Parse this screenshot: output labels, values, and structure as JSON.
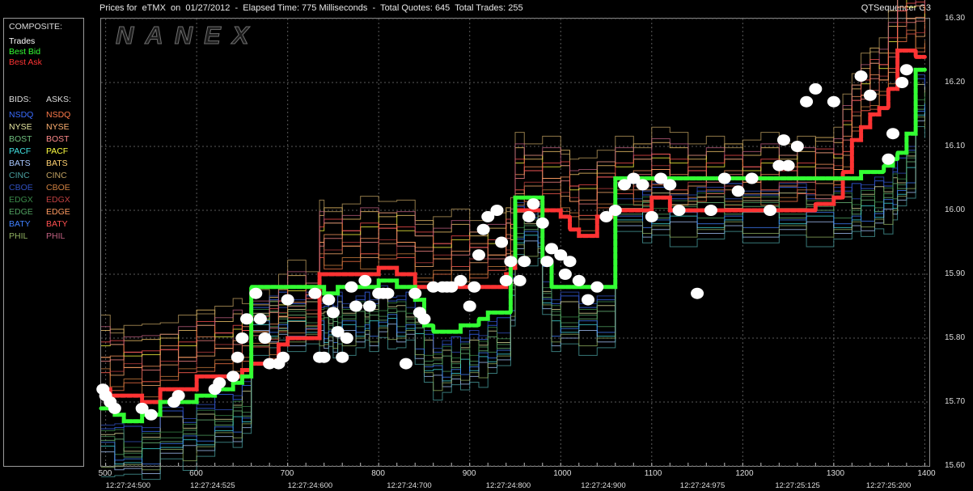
{
  "header": {
    "title": "Prices for  eTMX  on  01/27/2012  -  Elapsed Time: 775 Milliseconds  -  Total Quotes: 645  Total Trades: 255",
    "app": "QTSequencer G3"
  },
  "watermark": "NANEX",
  "legend": {
    "composite_title": "COMPOSITE:",
    "composite": [
      {
        "label": "Trades",
        "color": "#ffffff"
      },
      {
        "label": "Best Bid",
        "color": "#33ff33"
      },
      {
        "label": "Best Ask",
        "color": "#ff3333"
      }
    ],
    "bids_title": "BIDS:",
    "asks_title": "ASKS:",
    "exchanges": [
      {
        "bid": "NSDQ",
        "ask": "NSDQ",
        "bid_color": "#3a6cff",
        "ask_color": "#ff7a4a"
      },
      {
        "bid": "NYSE",
        "ask": "NYSE",
        "bid_color": "#e6e6a0",
        "ask_color": "#ffb070"
      },
      {
        "bid": "BOST",
        "ask": "BOST",
        "bid_color": "#6fc07f",
        "ask_color": "#ff8a8a"
      },
      {
        "bid": "PACF",
        "ask": "PACF",
        "bid_color": "#40e0e0",
        "ask_color": "#ffff40"
      },
      {
        "bid": "BATS",
        "ask": "BATS",
        "bid_color": "#a8c8ff",
        "ask_color": "#ffd070"
      },
      {
        "bid": "CINC",
        "ask": "CINC",
        "bid_color": "#4aa0a0",
        "ask_color": "#c0a060"
      },
      {
        "bid": "CBOE",
        "ask": "CBOE",
        "bid_color": "#3050c0",
        "ask_color": "#d08040"
      },
      {
        "bid": "EDGX",
        "ask": "EDGX",
        "bid_color": "#3a8a4a",
        "ask_color": "#c04040"
      },
      {
        "bid": "EDGE",
        "ask": "EDGE",
        "bid_color": "#50a060",
        "ask_color": "#ff9a60"
      },
      {
        "bid": "BATY",
        "ask": "BATY",
        "bid_color": "#4080ff",
        "ask_color": "#ff5050"
      },
      {
        "bid": "PHIL",
        "ask": "PHIL",
        "bid_color": "#90b060",
        "ask_color": "#c06080"
      }
    ]
  },
  "chart_data": {
    "type": "line",
    "title": "Prices for  eTMX  on  01/27/2012",
    "x_seq_ticks": [
      "500",
      "600",
      "700",
      "800",
      "900",
      "1000",
      "1100",
      "1200",
      "1300",
      "1400"
    ],
    "x_time_ticks": [
      "12:27:24:500",
      "12:27:24:525",
      "12:27:24:600",
      "12:27:24:700",
      "12:27:24:800",
      "12:27:24:900",
      "12:27:24:975",
      "12:27:25:125",
      "12:27:25:200"
    ],
    "y_ticks": [
      "16.30",
      "16.20",
      "16.10",
      "16.00",
      "15.90",
      "15.80",
      "15.70",
      "15.60"
    ],
    "xlim": [
      495,
      1405
    ],
    "ylim": [
      15.6,
      16.3
    ],
    "grid": true,
    "series": [
      {
        "name": "Best Bid",
        "color": "#33ff33",
        "x": [
          495,
          510,
          520,
          540,
          560,
          585,
          600,
          620,
          640,
          650,
          660,
          680,
          690,
          700,
          720,
          735,
          740,
          745,
          750,
          755,
          760,
          775,
          785,
          790,
          800,
          810,
          820,
          830,
          840,
          850,
          860,
          870,
          880,
          890,
          900,
          910,
          920,
          930,
          945,
          950,
          960,
          975,
          980,
          990,
          1000,
          1020,
          1040,
          1060,
          1090,
          1100,
          1120,
          1150,
          1180,
          1200,
          1240,
          1270,
          1300,
          1320,
          1330,
          1345,
          1355,
          1365,
          1370,
          1380,
          1390,
          1400
        ],
        "y": [
          15.69,
          15.68,
          15.67,
          15.68,
          15.7,
          15.7,
          15.71,
          15.72,
          15.73,
          15.74,
          15.88,
          15.88,
          15.88,
          15.88,
          15.88,
          15.88,
          15.87,
          15.87,
          15.87,
          15.88,
          15.88,
          15.88,
          15.88,
          15.88,
          15.89,
          15.89,
          15.88,
          15.88,
          15.86,
          15.82,
          15.81,
          15.81,
          15.81,
          15.82,
          15.82,
          15.83,
          15.84,
          15.84,
          15.92,
          16.02,
          16.02,
          16.02,
          15.92,
          15.88,
          15.88,
          15.88,
          15.88,
          16.05,
          16.05,
          16.05,
          16.05,
          16.05,
          16.05,
          16.05,
          16.05,
          16.05,
          16.05,
          16.05,
          16.06,
          16.06,
          16.07,
          16.08,
          16.09,
          16.12,
          16.22,
          16.22
        ]
      },
      {
        "name": "Best Ask",
        "color": "#ff3333",
        "x": [
          495,
          505,
          520,
          540,
          560,
          580,
          600,
          620,
          640,
          650,
          660,
          680,
          690,
          700,
          720,
          735,
          740,
          760,
          780,
          800,
          820,
          840,
          860,
          880,
          900,
          920,
          940,
          945,
          950,
          960,
          980,
          1000,
          1010,
          1020,
          1040,
          1060,
          1080,
          1100,
          1120,
          1140,
          1160,
          1180,
          1200,
          1220,
          1240,
          1260,
          1280,
          1300,
          1310,
          1320,
          1330,
          1340,
          1350,
          1360,
          1370,
          1380,
          1390,
          1400
        ],
        "y": [
          15.72,
          15.71,
          15.71,
          15.7,
          15.72,
          15.72,
          15.74,
          15.74,
          15.74,
          15.75,
          15.76,
          15.76,
          15.79,
          15.8,
          15.8,
          15.9,
          15.9,
          15.9,
          15.9,
          15.91,
          15.9,
          15.88,
          15.88,
          15.88,
          15.88,
          15.88,
          15.9,
          15.91,
          16.0,
          16.0,
          16.0,
          15.99,
          15.97,
          15.96,
          15.99,
          16.0,
          16.0,
          16.02,
          16.0,
          16.0,
          16.0,
          16.0,
          16.0,
          16.0,
          16.0,
          16.0,
          16.01,
          16.02,
          16.06,
          16.11,
          16.13,
          16.15,
          16.16,
          16.19,
          16.25,
          16.25,
          16.24,
          16.24
        ]
      },
      {
        "name": "Trades",
        "color": "#ffffff",
        "x": [
          497,
          500,
          505,
          510,
          540,
          550,
          575,
          580,
          620,
          625,
          640,
          645,
          650,
          655,
          665,
          670,
          675,
          680,
          690,
          695,
          700,
          730,
          735,
          740,
          745,
          750,
          755,
          760,
          765,
          770,
          775,
          785,
          790,
          800,
          805,
          810,
          830,
          840,
          845,
          850,
          860,
          870,
          875,
          880,
          890,
          900,
          905,
          910,
          915,
          920,
          930,
          935,
          940,
          945,
          955,
          960,
          965,
          970,
          980,
          985,
          990,
          1000,
          1005,
          1010,
          1020,
          1030,
          1040,
          1050,
          1060,
          1070,
          1080,
          1090,
          1100,
          1110,
          1120,
          1130,
          1150,
          1165,
          1180,
          1195,
          1210,
          1230,
          1240,
          1245,
          1250,
          1260,
          1270,
          1280,
          1300,
          1330,
          1340,
          1360,
          1365,
          1375,
          1380
        ],
        "y": [
          15.72,
          15.71,
          15.7,
          15.69,
          15.69,
          15.68,
          15.7,
          15.71,
          15.72,
          15.73,
          15.74,
          15.77,
          15.8,
          15.83,
          15.87,
          15.83,
          15.8,
          15.76,
          15.76,
          15.77,
          15.86,
          15.87,
          15.77,
          15.77,
          15.86,
          15.84,
          15.81,
          15.77,
          15.8,
          15.88,
          15.85,
          15.89,
          15.85,
          15.87,
          15.87,
          15.87,
          15.76,
          15.87,
          15.84,
          15.83,
          15.88,
          15.88,
          15.88,
          15.88,
          15.89,
          15.85,
          15.88,
          15.93,
          15.97,
          15.99,
          16.0,
          15.95,
          15.89,
          15.92,
          15.89,
          15.92,
          15.99,
          16.01,
          15.98,
          15.92,
          15.94,
          15.93,
          15.9,
          15.92,
          15.89,
          15.86,
          15.88,
          15.99,
          16.0,
          16.04,
          16.05,
          16.04,
          15.99,
          16.05,
          16.04,
          16.0,
          15.87,
          16.0,
          16.05,
          16.03,
          16.05,
          16.0,
          16.07,
          16.11,
          16.07,
          16.1,
          16.17,
          16.19,
          16.17,
          16.21,
          16.18,
          16.08,
          16.12,
          16.2,
          16.22
        ]
      }
    ]
  },
  "colors": {
    "background": "#000000",
    "grid": "#5a5a5a",
    "frame": "#8a8a8a"
  }
}
